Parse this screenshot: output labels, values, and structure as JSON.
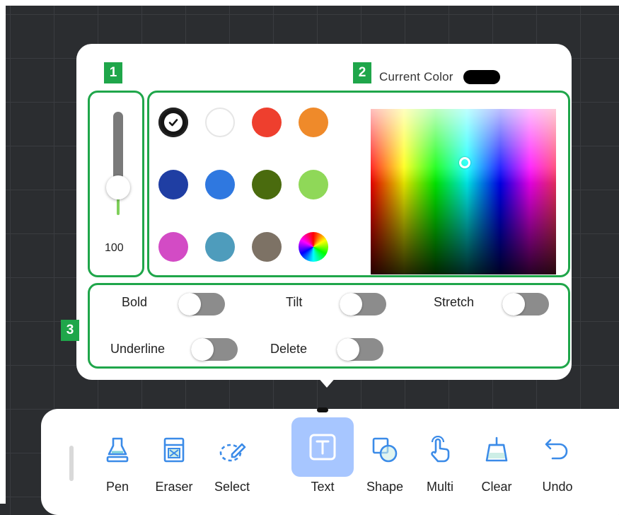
{
  "colors": {
    "accent_green": "#1fa64a",
    "icon_blue": "#3b8be8",
    "active_tool_bg": "#a7c6ff"
  },
  "badges": [
    "1",
    "2",
    "3"
  ],
  "panel": {
    "current_color_label": "Current Color",
    "current_color_value": "#000000",
    "size_slider": {
      "value": 100
    },
    "swatches": [
      {
        "name": "black",
        "color": "#151515",
        "selected": true
      },
      {
        "name": "white",
        "color": "#ffffff",
        "selected": false
      },
      {
        "name": "red",
        "color": "#ee3f2e",
        "selected": false
      },
      {
        "name": "orange",
        "color": "#ef8a2a",
        "selected": false
      },
      {
        "name": "navy",
        "color": "#1f3ea3",
        "selected": false
      },
      {
        "name": "blue",
        "color": "#2f78e0",
        "selected": false
      },
      {
        "name": "dark-green",
        "color": "#4a6b0e",
        "selected": false
      },
      {
        "name": "light-green",
        "color": "#8fd858",
        "selected": false
      },
      {
        "name": "magenta",
        "color": "#d34bc5",
        "selected": false
      },
      {
        "name": "teal",
        "color": "#4e9cbc",
        "selected": false
      },
      {
        "name": "taupe",
        "color": "#7d7265",
        "selected": false
      },
      {
        "name": "color-wheel",
        "color": "multicolor",
        "selected": false
      }
    ],
    "options": [
      {
        "label": "Bold",
        "on": false
      },
      {
        "label": "Tilt",
        "on": false
      },
      {
        "label": "Stretch",
        "on": false
      },
      {
        "label": "Underline",
        "on": false
      },
      {
        "label": "Delete",
        "on": false
      }
    ]
  },
  "toolbar": {
    "tools": [
      {
        "label": "Pen",
        "icon": "pen-icon",
        "active": false
      },
      {
        "label": "Eraser",
        "icon": "eraser-icon",
        "active": false
      },
      {
        "label": "Select",
        "icon": "lasso-select-icon",
        "active": false
      },
      {
        "label": "Text",
        "icon": "text-icon",
        "active": true
      },
      {
        "label": "Shape",
        "icon": "shape-icon",
        "active": false
      },
      {
        "label": "Multi",
        "icon": "multi-touch-icon",
        "active": false
      },
      {
        "label": "Clear",
        "icon": "clear-icon",
        "active": false
      },
      {
        "label": "Undo",
        "icon": "undo-icon",
        "active": false
      }
    ]
  }
}
